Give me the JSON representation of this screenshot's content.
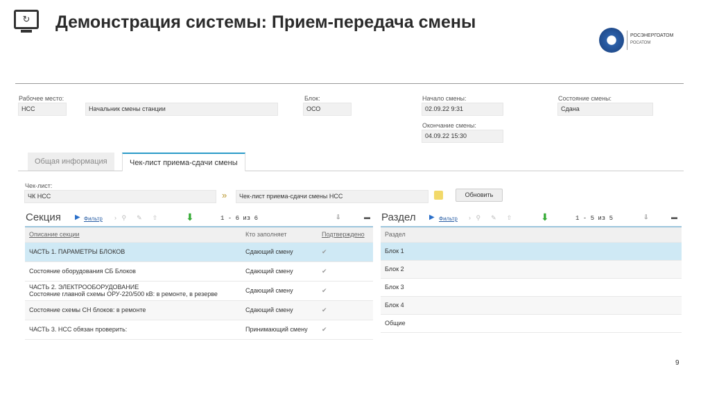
{
  "title": "Демонстрация системы: Прием-передача смены",
  "logo": {
    "name": "РОСЭНЕРГОАТОМ",
    "sub": "РОСАТОМ"
  },
  "header": {
    "workplace_label": "Рабочее место:",
    "workplace_code": "НСС",
    "workplace_name": "Начальник смены станции",
    "block_label": "Блок:",
    "block_value": "ОСО",
    "start_label": "Начало смены:",
    "start_value": "02.09.22 9:31",
    "end_label": "Окончание смены:",
    "end_value": "04.09.22 15:30",
    "state_label": "Состояние смены:",
    "state_value": "Сдана"
  },
  "tabs": [
    {
      "label": "Общая информация"
    },
    {
      "label": "Чек-лист приема-сдачи смены"
    }
  ],
  "checklist": {
    "label": "Чек-лист:",
    "code": "ЧК НСС",
    "name": "Чек-лист приема-сдачи смены НСС",
    "refresh": "Обновить"
  },
  "section": {
    "title": "Секция",
    "filter": "Фильтр",
    "paging": "1 - 6 из 6",
    "columns": [
      "Описание секции",
      "Кто заполняет",
      "Подтверждено"
    ],
    "rows": [
      {
        "desc": "ЧАСТЬ 1. ПАРАМЕТРЫ БЛОКОВ",
        "who": "Сдающий смену",
        "ok": "✔"
      },
      {
        "desc": "Состояние оборудования СБ Блоков",
        "who": "Сдающий смену",
        "ok": "✔"
      },
      {
        "desc": "ЧАСТЬ 2. ЭЛЕКТРООБОРУДОВАНИЕ",
        "desc2": "Состояние главной схемы ОРУ-220/500 кВ: в ремонте, в резерве",
        "who": "Сдающий смену",
        "ok": "✔"
      },
      {
        "desc": "Состояние схемы СН блоков: в ремонте",
        "who": "Сдающий смену",
        "ok": "✔"
      },
      {
        "desc": "ЧАСТЬ 3. НСС обязан проверить:",
        "who": "Принимающий смену",
        "ok": "✔"
      }
    ]
  },
  "part": {
    "title": "Раздел",
    "filter": "Фильтр",
    "paging": "1 - 5 из 5",
    "column": "Раздел",
    "rows": [
      "Блок 1",
      "Блок 2",
      "Блок 3",
      "Блок 4",
      "Общие"
    ]
  },
  "page_number": "9"
}
